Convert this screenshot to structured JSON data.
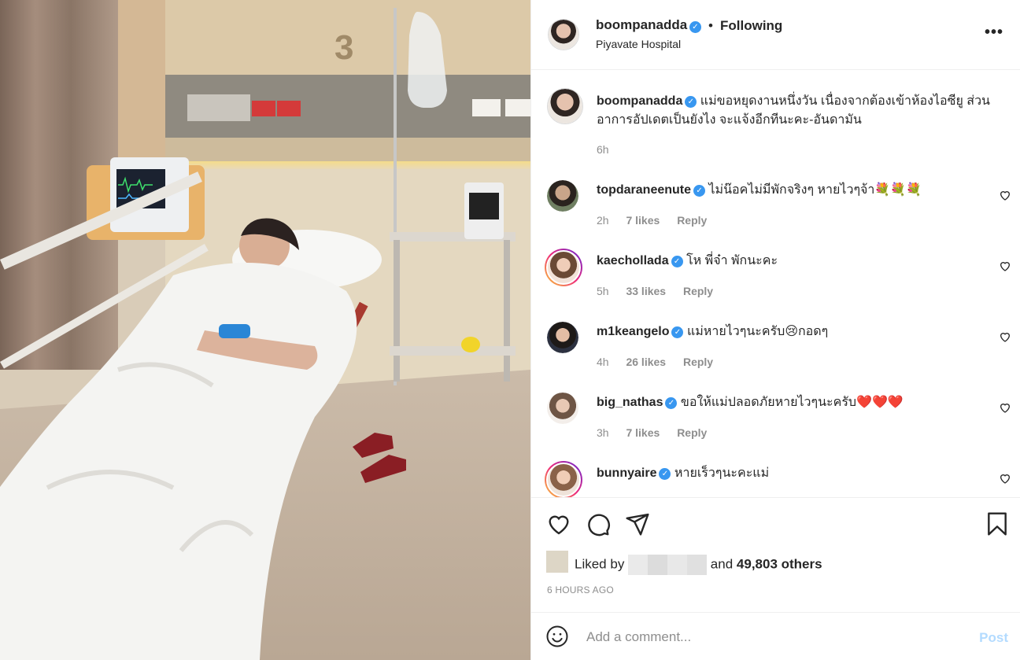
{
  "header": {
    "username": "boompanadda",
    "separator": "•",
    "follow_label": "Following",
    "location": "Piyavate Hospital",
    "more_glyph": "•••"
  },
  "caption": {
    "username": "boompanadda",
    "text": "แม่ขอหยุดงานหนึ่งวัน เนื่องจากต้องเข้าห้องไอซียู ส่วนอาการอัปเดตเป็นยังไง จะแจ้งอีกทีนะคะ-อันดามัน",
    "time": "6h"
  },
  "comments": [
    {
      "username": "topdaraneenute",
      "text": "ไม่น๊อคไม่มีพักจริงๆ หายไวๆจ้า💐💐💐",
      "time": "2h",
      "likes": "7 likes",
      "reply": "Reply"
    },
    {
      "username": "kaechollada",
      "text": "โห พี่จ๋า พักนะคะ",
      "time": "5h",
      "likes": "33 likes",
      "reply": "Reply"
    },
    {
      "username": "m1keangelo",
      "text": "แม่หายไวๆนะครับ😢กอดๆ",
      "time": "4h",
      "likes": "26 likes",
      "reply": "Reply"
    },
    {
      "username": "big_nathas",
      "text": "ขอให้แม่ปลอดภัยหายไวๆนะครับ❤️❤️❤️",
      "time": "3h",
      "likes": "7 likes",
      "reply": "Reply"
    },
    {
      "username": "bunnyaire",
      "text": "หายเร็วๆนะคะแม่"
    }
  ],
  "actions": {
    "liked_prefix": "Liked by",
    "liked_and": "and",
    "liked_count": "49,803 others",
    "time_ago": "6 HOURS AGO"
  },
  "add_comment": {
    "placeholder": "Add a comment...",
    "post_label": "Post"
  },
  "photo": {
    "room_number": "3"
  },
  "icons": [
    "heart-icon",
    "comment-icon",
    "share-icon",
    "bookmark-icon",
    "emoji-icon",
    "more-icon",
    "verified-badge-icon"
  ],
  "colors": {
    "verified": "#3897f0",
    "post_disabled": "#b3dbff",
    "muted": "#8e8e8e"
  }
}
